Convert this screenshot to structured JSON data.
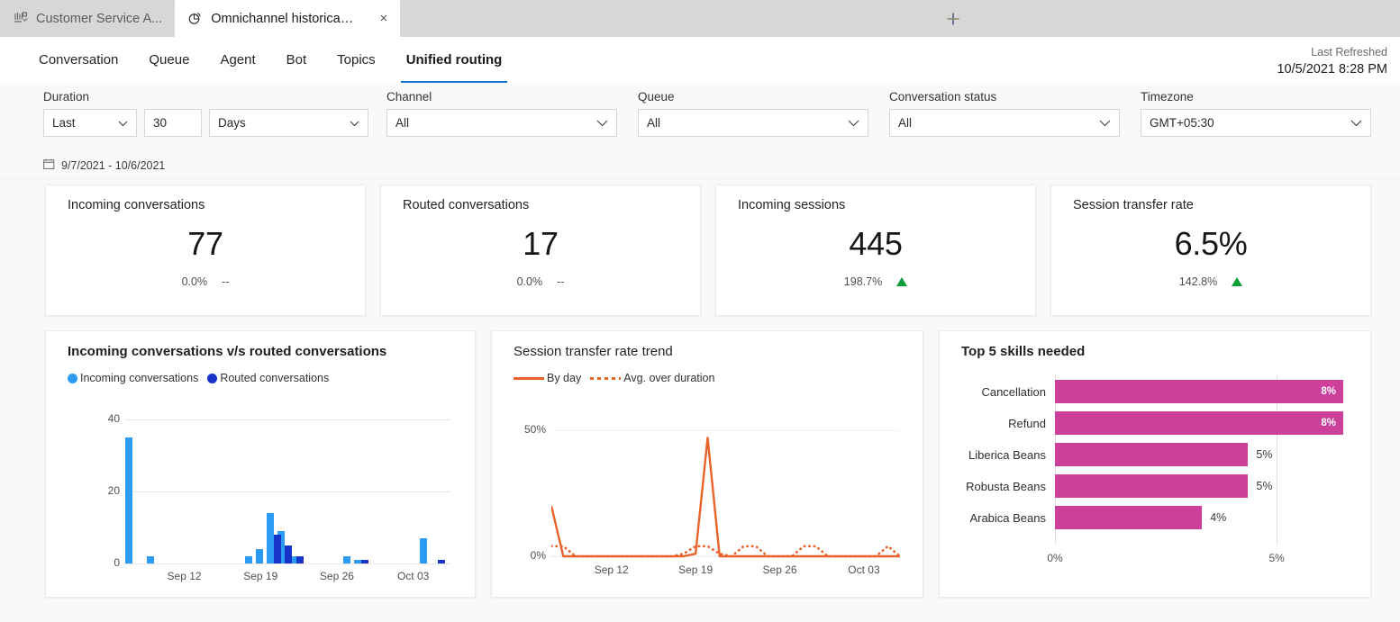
{
  "browser": {
    "tabs": [
      {
        "title": "Customer Service A...",
        "icon": "dashboard-grid-icon",
        "active": false,
        "closable": false
      },
      {
        "title": "Omnichannel historical a...",
        "icon": "pie-chart-icon",
        "active": true,
        "closable": true,
        "close_label": "×"
      }
    ],
    "new_tab_label": "+"
  },
  "nav": {
    "items": [
      {
        "label": "Conversation",
        "selected": false
      },
      {
        "label": "Queue",
        "selected": false
      },
      {
        "label": "Agent",
        "selected": false
      },
      {
        "label": "Bot",
        "selected": false
      },
      {
        "label": "Topics",
        "selected": false
      },
      {
        "label": "Unified routing",
        "selected": true
      }
    ],
    "accent_color": "#1577d1",
    "last_refreshed_label": "Last Refreshed",
    "last_refreshed_value": "10/5/2021 8:28 PM"
  },
  "filters": {
    "duration": {
      "label": "Duration",
      "mode_value": "Last",
      "amount_value": "30",
      "unit_value": "Days",
      "range_text": "9/7/2021 - 10/6/2021",
      "range_icon": "calendar-icon"
    },
    "channel": {
      "label": "Channel",
      "value": "All"
    },
    "queue": {
      "label": "Queue",
      "value": "All"
    },
    "conversation_status": {
      "label": "Conversation status",
      "value": "All"
    },
    "timezone": {
      "label": "Timezone",
      "value": "GMT+05:30"
    }
  },
  "kpis": [
    {
      "title": "Incoming conversations",
      "value": "77",
      "delta": "0.0%",
      "trend": "--",
      "trend_dir": "none"
    },
    {
      "title": "Routed conversations",
      "value": "17",
      "delta": "0.0%",
      "trend": "--",
      "trend_dir": "none"
    },
    {
      "title": "Incoming sessions",
      "value": "445",
      "delta": "198.7%",
      "trend": "▲",
      "trend_dir": "up"
    },
    {
      "title": "Session transfer rate",
      "value": "6.5%",
      "delta": "142.8%",
      "trend": "▲",
      "trend_dir": "up"
    }
  ],
  "chart_data": [
    {
      "type": "bar",
      "title": "Incoming conversations v/s routed conversations",
      "xlabel": "",
      "ylabel": "",
      "ylim": [
        0,
        40
      ],
      "yticks": [
        "0",
        "20",
        "40"
      ],
      "grid": true,
      "legend_position": "top-left",
      "x_tick_labels": [
        "Sep 12",
        "Sep 19",
        "Sep 26",
        "Oct 03"
      ],
      "x_tick_indices": [
        5,
        12,
        19,
        26
      ],
      "categories": [
        "Sep 07",
        "Sep 08",
        "Sep 09",
        "Sep 10",
        "Sep 11",
        "Sep 12",
        "Sep 13",
        "Sep 14",
        "Sep 15",
        "Sep 16",
        "Sep 17",
        "Sep 18",
        "Sep 19",
        "Sep 20",
        "Sep 21",
        "Sep 22",
        "Sep 23",
        "Sep 24",
        "Sep 25",
        "Sep 26",
        "Sep 27",
        "Sep 28",
        "Sep 29",
        "Sep 30",
        "Oct 01",
        "Oct 02",
        "Oct 03",
        "Oct 04",
        "Oct 05",
        "Oct 06"
      ],
      "series": [
        {
          "name": "Incoming conversations",
          "color": "#2b9bf4",
          "values": [
            35,
            0,
            2,
            0,
            0,
            0,
            0,
            0,
            0,
            0,
            0,
            2,
            4,
            14,
            9,
            2,
            0,
            0,
            0,
            0,
            2,
            1,
            0,
            0,
            0,
            0,
            0,
            7,
            0,
            0
          ]
        },
        {
          "name": "Routed conversations",
          "color": "#1634c9",
          "values": [
            0,
            0,
            0,
            0,
            0,
            0,
            0,
            0,
            0,
            0,
            0,
            0,
            0,
            8,
            5,
            2,
            0,
            0,
            0,
            0,
            0,
            1,
            0,
            0,
            0,
            0,
            0,
            0,
            1,
            0
          ]
        }
      ]
    },
    {
      "type": "line",
      "title": "Session transfer rate trend",
      "xlabel": "",
      "ylabel": "",
      "ylim": [
        0,
        50
      ],
      "yticks": [
        "0%",
        "50%"
      ],
      "grid": true,
      "legend_position": "top-left",
      "x_tick_labels": [
        "Sep 12",
        "Sep 19",
        "Sep 26",
        "Oct 03"
      ],
      "x_tick_indices": [
        5,
        12,
        19,
        26
      ],
      "x": [
        "Sep 07",
        "Sep 08",
        "Sep 09",
        "Sep 10",
        "Sep 11",
        "Sep 12",
        "Sep 13",
        "Sep 14",
        "Sep 15",
        "Sep 16",
        "Sep 17",
        "Sep 18",
        "Sep 19",
        "Sep 20",
        "Sep 21",
        "Sep 22",
        "Sep 23",
        "Sep 24",
        "Sep 25",
        "Sep 26",
        "Sep 27",
        "Sep 28",
        "Sep 29",
        "Sep 30",
        "Oct 01",
        "Oct 02",
        "Oct 03",
        "Oct 04",
        "Oct 05",
        "Oct 06"
      ],
      "series": [
        {
          "name": "By day",
          "style": "solid",
          "color": "#e8622a",
          "values": [
            20,
            0,
            0,
            0,
            0,
            0,
            0,
            0,
            0,
            0,
            0,
            0,
            1,
            47,
            0,
            0,
            0,
            0,
            0,
            0,
            0,
            0,
            0,
            0,
            0,
            0,
            0,
            0,
            0,
            0
          ]
        },
        {
          "name": "Avg. over duration",
          "style": "dotted",
          "color": "#e8622a",
          "values": [
            4,
            4,
            0,
            0,
            0,
            0,
            0,
            0,
            0,
            0,
            0,
            1,
            4,
            4,
            1,
            0,
            4,
            4,
            0,
            0,
            0,
            4,
            4,
            0,
            0,
            0,
            0,
            0,
            4,
            0
          ]
        }
      ]
    },
    {
      "type": "bar",
      "orientation": "horizontal",
      "title": "Top 5 skills needed",
      "xlabel": "",
      "ylabel": "",
      "xlim": [
        0,
        6.5
      ],
      "xticks": [
        "0%",
        "5%"
      ],
      "xtick_values": [
        0,
        5
      ],
      "grid": true,
      "bar_color": "#cc3f9a",
      "categories": [
        "Cancellation",
        "Refund",
        "Liberica Beans",
        "Robusta Beans",
        "Arabica Beans"
      ],
      "values": [
        8,
        8,
        5,
        5,
        4
      ],
      "value_labels": [
        "8%",
        "8%",
        "5%",
        "5%",
        "4%"
      ],
      "bar_widths_pct": [
        100,
        100,
        67,
        67,
        51
      ],
      "label_inside": [
        true,
        true,
        false,
        false,
        false
      ]
    }
  ]
}
